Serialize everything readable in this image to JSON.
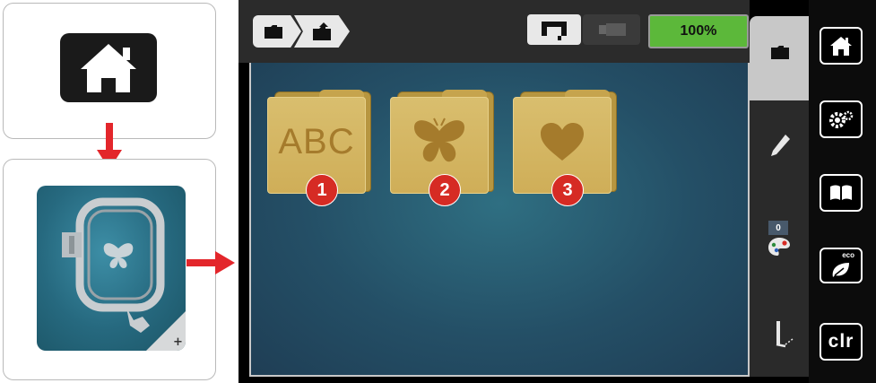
{
  "screen": {
    "battery_label": "100%",
    "folders": [
      {
        "label": "ABC",
        "badge": "1"
      },
      {
        "label": "",
        "badge": "2"
      },
      {
        "label": "",
        "badge": "3"
      }
    ],
    "sidebar": {
      "color_count": "0"
    },
    "right_menu": {
      "clr_label": "clr",
      "eco_label": "eco"
    }
  },
  "colors": {
    "battery": "#5cb83a",
    "badge": "#d62b24",
    "folder": "#d4b35e",
    "arrow": "#e3262b",
    "screen_bg": "#2a5c72"
  },
  "icons": [
    "home-icon",
    "embroidery-hoop-icon",
    "folder-icon",
    "folder-upload-icon",
    "sewing-machine-icon",
    "usb-stick-icon",
    "pencil-icon",
    "color-palette-icon",
    "needle-icon",
    "gears-icon",
    "book-icon",
    "eco-leaf-icon",
    "butterfly-icon",
    "heart-icon"
  ]
}
